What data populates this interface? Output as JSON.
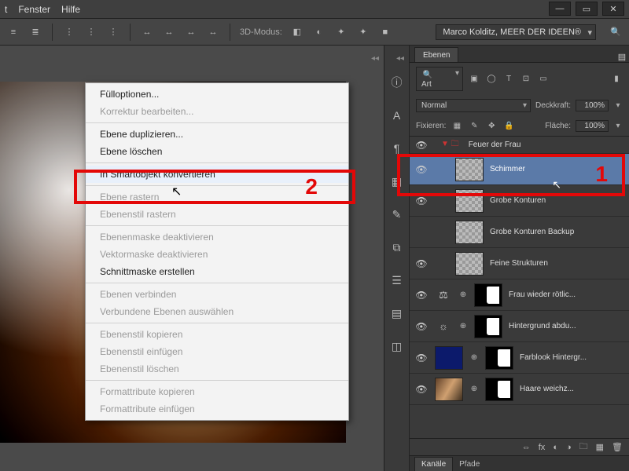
{
  "menubar": {
    "items": [
      "t",
      "Fenster",
      "Hilfe"
    ]
  },
  "window_controls": {
    "min": "—",
    "max": "▭",
    "close": "✕"
  },
  "optbar": {
    "mode_label": "3D-Modus:",
    "company": "Marco Kolditz, MEER DER IDEEN®"
  },
  "panel": {
    "tab": "Ebenen",
    "kind": "Art",
    "blend": "Normal",
    "opacity_label": "Deckkraft:",
    "opacity": "100%",
    "lock_label": "Fixieren:",
    "fill_label": "Fläche:",
    "fill": "100%",
    "group_name": "Feuer der Frau",
    "layers": [
      {
        "name": "Schimmer",
        "selected": true,
        "eye": true,
        "thumb": "checker"
      },
      {
        "name": "Grobe Konturen",
        "eye": true,
        "thumb": "checker"
      },
      {
        "name": "Grobe Konturen Backup",
        "eye": false,
        "thumb": "checker"
      },
      {
        "name": "Feine Strukturen",
        "eye": true,
        "thumb": "checker"
      },
      {
        "name": "Frau wieder rötlic...",
        "eye": true,
        "thumb": "mask",
        "adj": "⚖",
        "fx": "⊕"
      },
      {
        "name": "Hintergrund abdu...",
        "eye": true,
        "thumb": "mask",
        "adj": "☼",
        "fx": "⊕"
      },
      {
        "name": "Farblook Hintergr...",
        "eye": true,
        "thumb": "mask",
        "dark": true,
        "fx": "⊕"
      },
      {
        "name": "Haare weichz...",
        "eye": true,
        "thumb": "mask",
        "photo": true,
        "fx": "⊕"
      }
    ],
    "subtabs": [
      "Kanäle",
      "Pfade"
    ]
  },
  "context_menu": {
    "items": [
      {
        "label": "Fülloptionen..."
      },
      {
        "label": "Korrektur bearbeiten...",
        "disabled": true
      },
      {
        "sep": true
      },
      {
        "label": "Ebene duplizieren..."
      },
      {
        "label": "Ebene löschen"
      },
      {
        "sep": true
      },
      {
        "label": "In Smartobjekt konvertieren",
        "hover": true
      },
      {
        "sep": true
      },
      {
        "label": "Ebene rastern",
        "disabled": true
      },
      {
        "label": "Ebenenstil rastern",
        "disabled": true
      },
      {
        "sep": true
      },
      {
        "label": "Ebenenmaske deaktivieren",
        "disabled": true
      },
      {
        "label": "Vektormaske deaktivieren",
        "disabled": true
      },
      {
        "label": "Schnittmaske erstellen"
      },
      {
        "sep": true
      },
      {
        "label": "Ebenen verbinden",
        "disabled": true
      },
      {
        "label": "Verbundene Ebenen auswählen",
        "disabled": true
      },
      {
        "sep": true
      },
      {
        "label": "Ebenenstil kopieren",
        "disabled": true
      },
      {
        "label": "Ebenenstil einfügen",
        "disabled": true
      },
      {
        "label": "Ebenenstil löschen",
        "disabled": true
      },
      {
        "sep": true
      },
      {
        "label": "Formattribute kopieren",
        "disabled": true
      },
      {
        "label": "Formattribute einfügen",
        "disabled": true
      }
    ]
  },
  "annotations": {
    "one": "1",
    "two": "2"
  },
  "icons": {
    "align_left": "≡",
    "align_c": "≣",
    "dist": "⋮",
    "arrow": "↔",
    "cube": "◧",
    "sphere": "◐",
    "light": "✦",
    "cam": "■",
    "search": "🔍",
    "info": "ⓘ",
    "letterA": "A",
    "swatch": "▦",
    "para": "¶",
    "brush": "✎",
    "clone": "⧉",
    "hist": "☰",
    "grid": "▤",
    "nav": "◫",
    "lock": "🔒",
    "fx": "fx",
    "mask": "◐",
    "adj": "◑",
    "folder": "🗀",
    "new": "▦",
    "trash": "🗑",
    "eye": "👁",
    "pict": "▣",
    "circ": "◯",
    "T": "T",
    "crop": "⊡",
    "box": "▭",
    "pixel": "▦",
    "brush2": "✎",
    "move": "✥",
    "plus": "✚"
  }
}
